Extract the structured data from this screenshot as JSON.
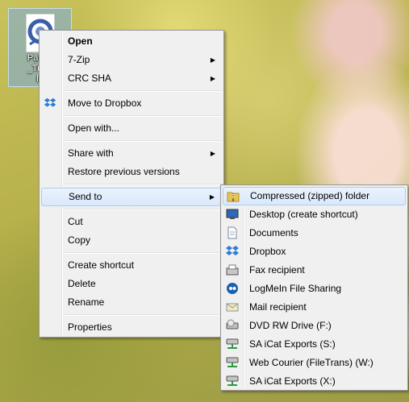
{
  "desktop": {
    "icon_label_lines": [
      "Patien",
      "_Treat",
      "la"
    ]
  },
  "context_menu": {
    "items": [
      {
        "label": "Open",
        "bold": true
      },
      {
        "label": "7-Zip",
        "submenu": true
      },
      {
        "label": "CRC SHA",
        "submenu": true
      },
      {
        "separator": true
      },
      {
        "label": "Move to Dropbox",
        "icon": "dropbox-icon"
      },
      {
        "separator": true
      },
      {
        "label": "Open with..."
      },
      {
        "separator": true
      },
      {
        "label": "Share with",
        "submenu": true
      },
      {
        "label": "Restore previous versions"
      },
      {
        "separator": true
      },
      {
        "label": "Send to",
        "submenu": true,
        "active": true
      },
      {
        "separator": true
      },
      {
        "label": "Cut"
      },
      {
        "label": "Copy"
      },
      {
        "separator": true
      },
      {
        "label": "Create shortcut"
      },
      {
        "label": "Delete"
      },
      {
        "label": "Rename"
      },
      {
        "separator": true
      },
      {
        "label": "Properties"
      }
    ]
  },
  "send_to_menu": {
    "items": [
      {
        "label": "Compressed (zipped) folder",
        "icon": "zip-folder-icon",
        "active": true
      },
      {
        "label": "Desktop (create shortcut)",
        "icon": "desktop-icon"
      },
      {
        "label": "Documents",
        "icon": "documents-icon"
      },
      {
        "label": "Dropbox",
        "icon": "dropbox-icon"
      },
      {
        "label": "Fax recipient",
        "icon": "fax-icon"
      },
      {
        "label": "LogMeIn File Sharing",
        "icon": "logmein-icon"
      },
      {
        "label": "Mail recipient",
        "icon": "mail-icon"
      },
      {
        "label": "DVD RW Drive (F:)",
        "icon": "dvd-drive-icon"
      },
      {
        "label": "SA iCat Exports (S:)",
        "icon": "network-drive-icon"
      },
      {
        "label": "Web Courier (FileTrans) (W:)",
        "icon": "network-drive-icon"
      },
      {
        "label": "SA iCat Exports (X:)",
        "icon": "network-drive-icon"
      }
    ]
  }
}
